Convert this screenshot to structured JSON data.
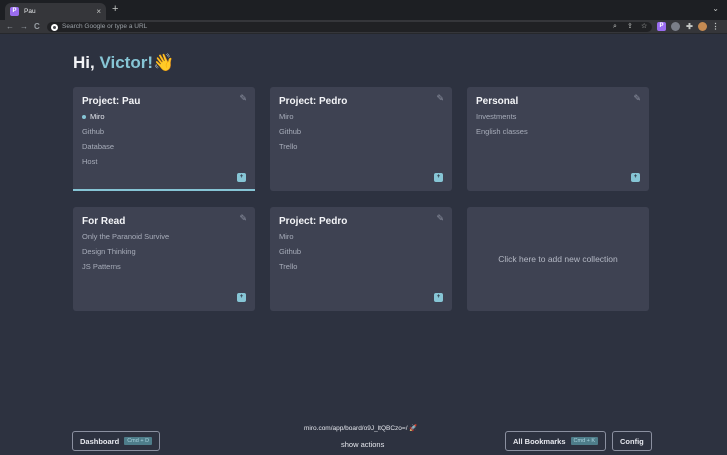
{
  "browser": {
    "tab_title": "Pau",
    "tab_favicon": "P",
    "tab_close": "×",
    "new_tab": "+",
    "tab_menu": "⌄",
    "omnibox_placeholder": "Search Google or type a URL",
    "back_icon": "←",
    "forward_icon": "→",
    "reload_icon": "C",
    "ext_icon_label": "P"
  },
  "greeting": {
    "prefix": "Hi, ",
    "name": "Victor!",
    "emoji": "👋"
  },
  "cards": [
    {
      "title": "Project: Pau",
      "items": [
        "Miro",
        "Github",
        "Database",
        "Host"
      ],
      "active_item": 0,
      "badge": "+",
      "edit_icon": "✎"
    },
    {
      "title": "Project: Pedro",
      "items": [
        "Miro",
        "Github",
        "Trello"
      ],
      "badge": "+",
      "edit_icon": "✎"
    },
    {
      "title": "Personal",
      "items": [
        "Investments",
        "English classes"
      ],
      "badge": "+",
      "edit_icon": "✎"
    },
    {
      "title": "For Read",
      "items": [
        "Only the Paranoid Survive",
        "Design Thinking",
        "JS Patterns"
      ],
      "badge": "+",
      "edit_icon": "✎"
    },
    {
      "title": "Project: Pedro",
      "items": [
        "Miro",
        "Github",
        "Trello"
      ],
      "badge": "+",
      "edit_icon": "✎"
    }
  ],
  "add_collection": "Click here to add new collection",
  "footer": {
    "dashboard_label": "Dashboard",
    "dashboard_shortcut": "Cmd + D",
    "url": "miro.com/app/board/o9J_ltQBCzo=/ 🚀",
    "show_actions": "show actions",
    "all_bookmarks_label": "All Bookmarks",
    "all_bookmarks_shortcut": "Cmd + K",
    "config_label": "Config"
  },
  "colors": {
    "background": "#2d3240",
    "card": "#3e4252",
    "accent": "#86c5d5"
  }
}
